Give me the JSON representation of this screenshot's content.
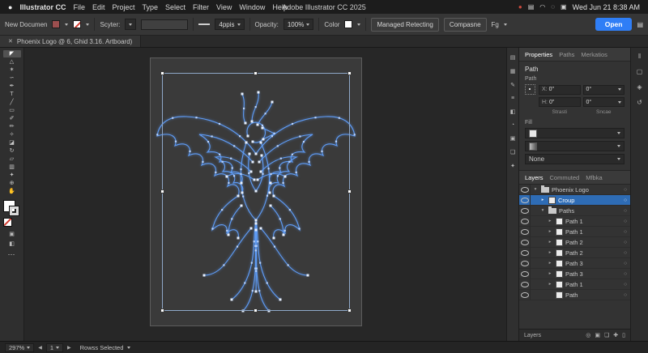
{
  "menubar": {
    "items": [
      "Illustrator CC",
      "File",
      "Edit",
      "Project",
      "Type",
      "Select",
      "Filter",
      "View",
      "Window",
      "Help"
    ],
    "title": "Adobe Illustrator CC 2025",
    "status_icons": [
      {
        "name": "record-dot-icon",
        "glyph": "●",
        "color": "#cb4a3d"
      },
      {
        "name": "display-icon",
        "glyph": "▤",
        "color": "#d5d5d5"
      },
      {
        "name": "wifi-icon",
        "glyph": "◠",
        "color": "#d5d5d5"
      },
      {
        "name": "search-icon",
        "glyph": "◌",
        "color": "#d5d5d5"
      },
      {
        "name": "control-center-icon",
        "glyph": "▣",
        "color": "#d5d5d5"
      }
    ],
    "clock": "Wed Jun 21  8:38 AM"
  },
  "controlbar": {
    "new_document_label": "New Documen",
    "style_label": "Scyter:",
    "stroke_weight_value": "4ppis",
    "opacity_label": "Opacity:",
    "opacity_value": "100%",
    "color_label": "Color",
    "managed_button": "Managed Retecting",
    "compose_button": "Compasne",
    "fx_label": "Fg",
    "open_button": "Open"
  },
  "doc_tab": {
    "close_glyph": "✕",
    "title": "Phoenix Logo @ 6, Ghid 3.16. Artboard)"
  },
  "tools": [
    {
      "name": "selection-tool",
      "glyph": "◤"
    },
    {
      "name": "direct-selection-tool",
      "glyph": "△"
    },
    {
      "name": "magic-wand-tool",
      "glyph": "✶"
    },
    {
      "name": "lasso-tool",
      "glyph": "∽"
    },
    {
      "name": "pen-tool",
      "glyph": "✒"
    },
    {
      "name": "type-tool",
      "glyph": "T"
    },
    {
      "name": "line-segment-tool",
      "glyph": "╱"
    },
    {
      "name": "rectangle-tool",
      "glyph": "▭"
    },
    {
      "name": "paintbrush-tool",
      "glyph": "✐"
    },
    {
      "name": "pencil-tool",
      "glyph": "✏"
    },
    {
      "name": "shaper-tool",
      "glyph": "✧"
    },
    {
      "name": "eraser-tool",
      "glyph": "◪"
    },
    {
      "name": "rotate-tool",
      "glyph": "↻"
    },
    {
      "name": "scale-tool",
      "glyph": "▱"
    },
    {
      "name": "gradient-tool",
      "glyph": "▥"
    },
    {
      "name": "eyedropper-tool",
      "glyph": "✦"
    },
    {
      "name": "zoom-tool",
      "glyph": "⊕"
    },
    {
      "name": "hand-tool",
      "glyph": "✋"
    }
  ],
  "toolbar_extras": {
    "ellipsis": "⋯",
    "draw_icons": [
      {
        "name": "draw-normal-mode-icon",
        "glyph": "▣"
      },
      {
        "name": "screen-mode-icon",
        "glyph": "◧"
      }
    ]
  },
  "artwork": {
    "stroke_color": "#5f9df8",
    "anchor_color": "#b9d4ff",
    "endpoint_color": "#e8f1ff"
  },
  "dock_rail_icons": [
    {
      "name": "color-panel-icon",
      "glyph": "▤"
    },
    {
      "name": "swatches-panel-icon",
      "glyph": "▦"
    },
    {
      "name": "brushes-panel-icon",
      "glyph": "✎"
    },
    {
      "name": "stroke-panel-icon",
      "glyph": "≡"
    },
    {
      "name": "gradient-panel-icon",
      "glyph": "◧"
    },
    {
      "name": "transparency-panel-icon",
      "glyph": "◔"
    },
    {
      "name": "appearance-panel-icon",
      "glyph": "▣"
    },
    {
      "name": "graphic-styles-panel-icon",
      "glyph": "❏"
    },
    {
      "name": "symbols-panel-icon",
      "glyph": "✦"
    }
  ],
  "properties": {
    "tabs": [
      {
        "label": "Properties",
        "active": true
      },
      {
        "label": "Paths",
        "active": false
      },
      {
        "label": "Merkatios",
        "active": false
      }
    ],
    "section_title": "Path",
    "transform": {
      "title": "Path",
      "x_label": "X:",
      "x_value": "0\"",
      "h_label": "H:",
      "h_value": "0\"",
      "angle_value": "0°",
      "angle2_value": "0°",
      "caption1": "Strasti",
      "caption2": "Sncae"
    },
    "fill": {
      "label": "Fill",
      "none_label": "None"
    }
  },
  "layers": {
    "tabs": [
      {
        "label": "Layers",
        "active": true
      },
      {
        "label": "Commuted",
        "active": false
      },
      {
        "label": "Mfbka",
        "active": false
      }
    ],
    "target_glyph": "○",
    "rows": [
      {
        "name": "Phoenix Logo",
        "indent": 0,
        "arrow": "▾",
        "icon": "folder",
        "selected": false
      },
      {
        "name": "Croup",
        "indent": 1,
        "arrow": "▸",
        "icon": "thumb",
        "selected": true
      },
      {
        "name": "Paths",
        "indent": 1,
        "arrow": "▾",
        "icon": "folder",
        "selected": false
      },
      {
        "name": "Path 1",
        "indent": 2,
        "arrow": "▸",
        "icon": "thumb",
        "selected": false
      },
      {
        "name": "Path 1",
        "indent": 2,
        "arrow": "▸",
        "icon": "thumb",
        "selected": false
      },
      {
        "name": "Path 2",
        "indent": 2,
        "arrow": "▸",
        "icon": "thumb",
        "selected": false
      },
      {
        "name": "Path 2",
        "indent": 2,
        "arrow": "▸",
        "icon": "thumb",
        "selected": false
      },
      {
        "name": "Path 3",
        "indent": 2,
        "arrow": "▸",
        "icon": "thumb",
        "selected": false
      },
      {
        "name": "Path 3",
        "indent": 2,
        "arrow": "▸",
        "icon": "thumb",
        "selected": false
      },
      {
        "name": "Path 1",
        "indent": 2,
        "arrow": "▸",
        "icon": "thumb",
        "selected": false
      },
      {
        "name": "Path",
        "indent": 2,
        "arrow": "",
        "icon": "thumb",
        "selected": false
      }
    ],
    "bottom_label": "Layers",
    "bottom_icons": [
      {
        "name": "locate-object-icon",
        "glyph": "◎"
      },
      {
        "name": "make-clip-mask-icon",
        "glyph": "▣"
      },
      {
        "name": "new-sublayer-icon",
        "glyph": "❏"
      },
      {
        "name": "new-layer-icon",
        "glyph": "✚"
      },
      {
        "name": "delete-layer-icon",
        "glyph": "▯"
      }
    ]
  },
  "right_rail_icons": [
    {
      "name": "collapse-panels-icon",
      "glyph": "‖"
    },
    {
      "name": "libraries-panel-icon",
      "glyph": "▢"
    },
    {
      "name": "adjust-panel-icon",
      "glyph": "◈"
    },
    {
      "name": "history-panel-icon",
      "glyph": "↺"
    }
  ],
  "statusbar": {
    "zoom_value": "297%",
    "prev_glyph": "◀",
    "next_glyph": "▶",
    "artboard_field": "1",
    "status_label": "Rowss Selected"
  }
}
